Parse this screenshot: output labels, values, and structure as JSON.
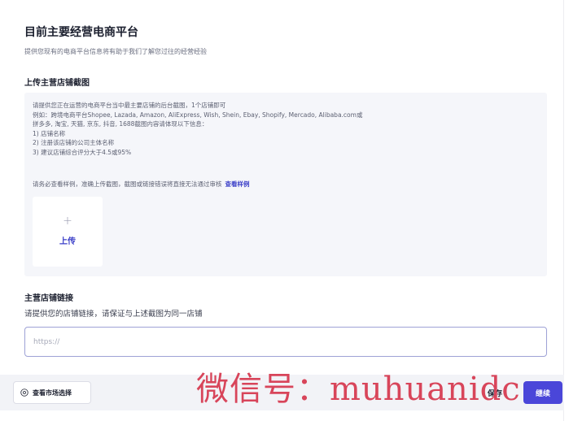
{
  "header": {
    "title": "目前主要经营电商平台",
    "subtitle": "提供您现有的电商平台信息将有助于我们了解您过往的经营经验"
  },
  "screenshot_section": {
    "title": "上传主营店铺截图",
    "lines": [
      "请提供您正在运营的电商平台当中最主要店铺的后台截图，1个店铺即可",
      "例如：跨境电商平台Shopee, Lazada, Amazon, AliExpress, Wish, Shein, Ebay, Shopify, Mercado, Alibaba.com或",
      "拼多多, 淘宝, 天猫, 京东, 抖音, 1688截图内容请体现以下信息：",
      "1) 店铺名称",
      "2) 注册该店铺的公司主体名称",
      "3) 建议店铺综合评分大于4.5或95%"
    ],
    "notice": "请务必查看样例，准确上传截图，截图或链接错误将直接无法通过审核",
    "sample_link": "查看样例",
    "upload": {
      "plus_icon": "+",
      "label": "上传"
    }
  },
  "link_section": {
    "title": "主营店铺链接",
    "description": "请提供您的店铺链接，请保证与上述截图为同一店铺",
    "placeholder": "https://",
    "value": ""
  },
  "footer": {
    "market_button": "查看市场选择",
    "save_button": "保存",
    "next_button": "继续"
  },
  "watermark": "微信号：muhuanidc",
  "colors": {
    "accent": "#4a46d9",
    "link": "#3b3fc8",
    "info_bg": "#f5f6fa",
    "watermark": "#d8455a"
  }
}
